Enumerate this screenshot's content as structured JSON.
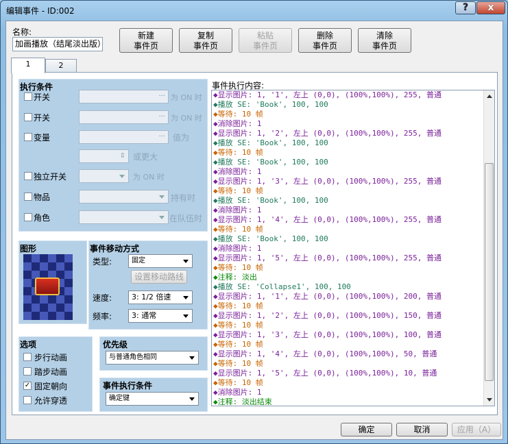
{
  "window": {
    "title": "编辑事件 - ID:002",
    "help": "?",
    "close": "x"
  },
  "name": {
    "label": "名称:",
    "value": "加画播放（结尾淡出版）"
  },
  "page_buttons": [
    {
      "line1": "新建",
      "line2": "事件页",
      "disabled": false
    },
    {
      "line1": "复制",
      "line2": "事件页",
      "disabled": false
    },
    {
      "line1": "粘贴",
      "line2": "事件页",
      "disabled": true
    },
    {
      "line1": "删除",
      "line2": "事件页",
      "disabled": false
    },
    {
      "line1": "清除",
      "line2": "事件页",
      "disabled": false
    }
  ],
  "tabs": [
    "1",
    "2"
  ],
  "conditions": {
    "title": "执行条件",
    "switch1": {
      "label": "开关",
      "suffix": "为 ON 时"
    },
    "switch2": {
      "label": "开关",
      "suffix": "为 ON 时"
    },
    "variable": {
      "label": "变量",
      "suffix": "值为"
    },
    "variable_more": "或更大",
    "self_switch": {
      "label": "独立开关",
      "suffix": "为 ON 时"
    },
    "item": {
      "label": "物品",
      "suffix": "持有时"
    },
    "actor": {
      "label": "角色",
      "suffix": "在队伍时"
    }
  },
  "graphic": {
    "title": "图形"
  },
  "movement": {
    "title": "事件移动方式",
    "type_label": "类型:",
    "type_value": "固定",
    "route_button": "设置移动路线",
    "speed_label": "速度:",
    "speed_value": "3: 1/2 倍速",
    "freq_label": "频率:",
    "freq_value": "3: 通常"
  },
  "options": {
    "title": "选项",
    "items": [
      {
        "label": "步行动画",
        "checked": false
      },
      {
        "label": "踏步动画",
        "checked": false
      },
      {
        "label": "固定朝向",
        "checked": true
      },
      {
        "label": "允许穿透",
        "checked": false
      }
    ]
  },
  "priority": {
    "title": "优先级",
    "value": "与普通角色相同"
  },
  "trigger": {
    "title": "事件执行条件",
    "value": "确定键"
  },
  "contents_label": "事件执行内容:",
  "colors": {
    "purple": "#7a1f9a",
    "green": "#1f7a5c",
    "orange": "#c86400",
    "bright_green": "#0a8a0a",
    "blue": "#1a4fb0"
  },
  "commands": [
    {
      "text": "◆显示图片: 1, '1', 左上 (0,0), (100%,100%), 255, 普通",
      "kind": "purple"
    },
    {
      "text": "◆播放 SE: 'Book', 100, 100",
      "kind": "green"
    },
    {
      "text": "◆等待: 10 帧",
      "kind": "orange"
    },
    {
      "text": "◆消除图片: 1",
      "kind": "purple"
    },
    {
      "text": "◆显示图片: 1, '2', 左上 (0,0), (100%,100%), 255, 普通",
      "kind": "purple"
    },
    {
      "text": "◆播放 SE: 'Book', 100, 100",
      "kind": "green"
    },
    {
      "text": "◆等待: 10 帧",
      "kind": "orange"
    },
    {
      "text": "◆播放 SE: 'Book', 100, 100",
      "kind": "green"
    },
    {
      "text": "◆消除图片: 1",
      "kind": "purple"
    },
    {
      "text": "◆显示图片: 1, '3', 左上 (0,0), (100%,100%), 255, 普通",
      "kind": "purple"
    },
    {
      "text": "◆等待: 10 帧",
      "kind": "orange"
    },
    {
      "text": "◆播放 SE: 'Book', 100, 100",
      "kind": "green"
    },
    {
      "text": "◆消除图片: 1",
      "kind": "purple"
    },
    {
      "text": "◆显示图片: 1, '4', 左上 (0,0), (100%,100%), 255, 普通",
      "kind": "purple"
    },
    {
      "text": "◆等待: 10 帧",
      "kind": "orange"
    },
    {
      "text": "◆播放 SE: 'Book', 100, 100",
      "kind": "green"
    },
    {
      "text": "◆消除图片: 1",
      "kind": "purple"
    },
    {
      "text": "◆显示图片: 1, '5', 左上 (0,0), (100%,100%), 255, 普通",
      "kind": "purple"
    },
    {
      "text": "◆等待: 10 帧",
      "kind": "orange"
    },
    {
      "text": "◆注释: 淡出",
      "kind": "bright_green"
    },
    {
      "text": "◆播放 SE: 'Collapse1', 100, 100",
      "kind": "green"
    },
    {
      "text": "◆显示图片: 1, '1', 左上 (0,0), (100%,100%), 200, 普通",
      "kind": "purple"
    },
    {
      "text": "◆等待: 10 帧",
      "kind": "orange"
    },
    {
      "text": "◆显示图片: 1, '2', 左上 (0,0), (100%,100%), 150, 普通",
      "kind": "purple"
    },
    {
      "text": "◆等待: 10 帧",
      "kind": "orange"
    },
    {
      "text": "◆显示图片: 1, '3', 左上 (0,0), (100%,100%), 100, 普通",
      "kind": "purple"
    },
    {
      "text": "◆等待: 10 帧",
      "kind": "orange"
    },
    {
      "text": "◆显示图片: 1, '4', 左上 (0,0), (100%,100%), 50, 普通",
      "kind": "purple"
    },
    {
      "text": "◆等待: 10 帧",
      "kind": "orange"
    },
    {
      "text": "◆显示图片: 1, '5', 左上 (0,0), (100%,100%), 10, 普通",
      "kind": "purple"
    },
    {
      "text": "◆等待: 10 帧",
      "kind": "orange"
    },
    {
      "text": "◆消除图片: 1",
      "kind": "purple"
    },
    {
      "text": "◆注释: 淡出结束",
      "kind": "bright_green"
    }
  ],
  "footer": {
    "ok": "确定",
    "cancel": "取消",
    "apply": "应用（A）"
  }
}
